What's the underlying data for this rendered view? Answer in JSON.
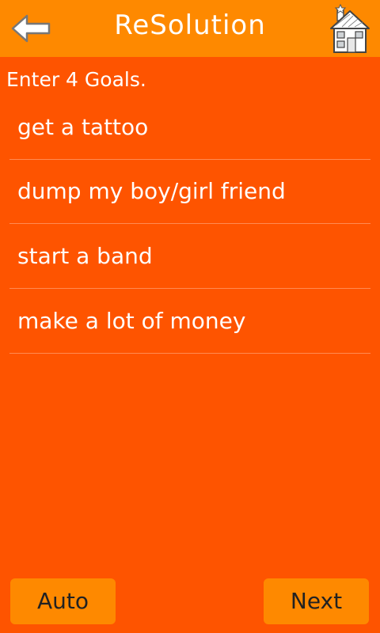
{
  "header": {
    "title": "ReSolution",
    "back_icon": "back-arrow-icon",
    "home_icon": "house-icon"
  },
  "instruction": "Enter 4 Goals.",
  "goals": [
    {
      "value": "get a tattoo"
    },
    {
      "value": "dump my boy/girl friend"
    },
    {
      "value": "start a band"
    },
    {
      "value": "make a lot of money"
    }
  ],
  "buttons": {
    "auto": "Auto",
    "next": "Next"
  },
  "colors": {
    "background": "#fe5400",
    "header": "#fe8900",
    "button": "#fe8900",
    "text": "#ffffff"
  }
}
